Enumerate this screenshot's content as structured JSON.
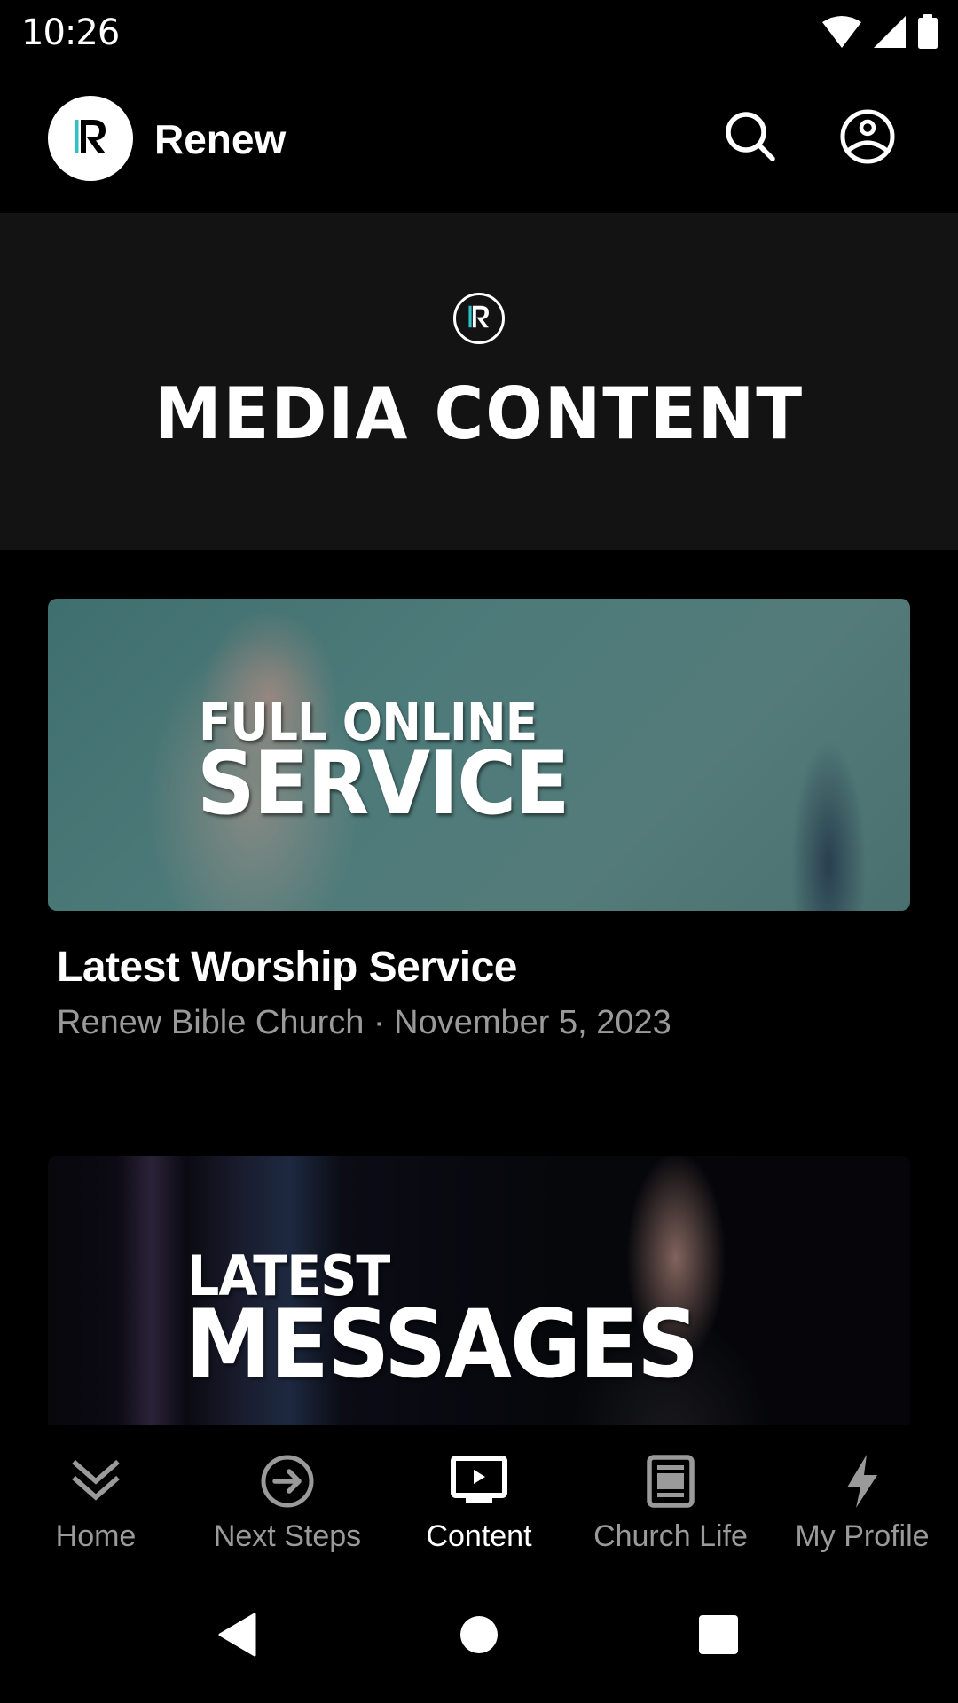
{
  "status_bar": {
    "time": "10:26",
    "icons": [
      "wifi-icon",
      "cellular-signal-icon",
      "battery-icon"
    ]
  },
  "app_bar": {
    "logo_icon": "renew-r-logo",
    "title": "Renew",
    "actions": [
      {
        "name": "search",
        "icon": "search-icon"
      },
      {
        "name": "account",
        "icon": "account-circle-icon"
      }
    ]
  },
  "hero": {
    "logo_icon": "renew-r-logo",
    "title": "MEDIA CONTENT"
  },
  "cards": [
    {
      "thumbnail_line_1": "FULL ONLINE",
      "thumbnail_line_2": "SERVICE",
      "title": "Latest Worship Service",
      "meta": "Renew Bible Church · November 5, 2023"
    },
    {
      "thumbnail_line_1": "LATEST",
      "thumbnail_line_2": "MESSAGES"
    }
  ],
  "bottom_nav": {
    "active_index": 2,
    "items": [
      {
        "label": "Home",
        "icon": "double-chevron-down-icon"
      },
      {
        "label": "Next Steps",
        "icon": "arrow-right-circle-icon"
      },
      {
        "label": "Content",
        "icon": "play-tv-icon"
      },
      {
        "label": "Church Life",
        "icon": "document-icon"
      },
      {
        "label": "My Profile",
        "icon": "lightning-bolt-icon"
      }
    ]
  },
  "system_nav": {
    "buttons": [
      "back",
      "home",
      "recents"
    ]
  },
  "colors": {
    "accent_cyan": "#2fc1c8",
    "background": "#000000",
    "banner": "#131313",
    "inactive_text": "#9a9a9a",
    "active_text": "#ffffff"
  }
}
